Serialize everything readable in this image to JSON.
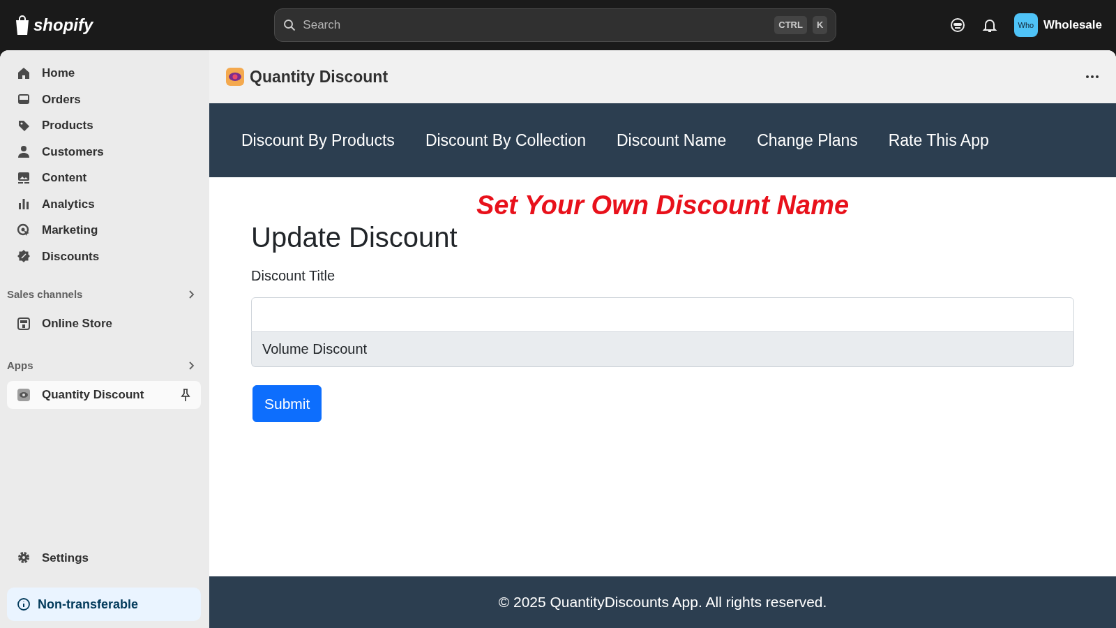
{
  "topbar": {
    "logo": "shopify",
    "search": {
      "placeholder": "Search",
      "shortcut": [
        "CTRL",
        "K"
      ]
    },
    "store": {
      "avatar": "Who",
      "name": "Wholesale"
    }
  },
  "sidebar": {
    "items": [
      {
        "label": "Home",
        "selected": false
      },
      {
        "label": "Orders",
        "selected": false
      },
      {
        "label": "Products",
        "selected": false
      },
      {
        "label": "Customers",
        "selected": false
      },
      {
        "label": "Content",
        "selected": false
      },
      {
        "label": "Analytics",
        "selected": false
      },
      {
        "label": "Marketing",
        "selected": false
      },
      {
        "label": "Discounts",
        "selected": false
      }
    ],
    "sections": [
      {
        "title": "Sales channels",
        "items": [
          {
            "label": "Online Store",
            "selected": false,
            "pinned": false
          }
        ]
      },
      {
        "title": "Apps",
        "items": [
          {
            "label": "Quantity Discount",
            "selected": true,
            "pinned": true
          }
        ]
      }
    ],
    "settings": "Settings",
    "notice": "Non-transferable"
  },
  "app": {
    "title": "Quantity Discount",
    "tabs": [
      {
        "label": "Discount By Products",
        "selected": false
      },
      {
        "label": "Discount By Collection",
        "selected": false
      },
      {
        "label": "Discount Name",
        "selected": false
      },
      {
        "label": "Change Plans",
        "selected": false
      },
      {
        "label": "Rate This App",
        "selected": false
      }
    ],
    "banner": "Set Your Own Discount Name",
    "heading": "Update Discount",
    "field_label": "Discount Title",
    "current_value": "Volume Discount",
    "submit": "Submit",
    "footer": "© 2025 QuantityDiscounts App. All rights reserved."
  }
}
